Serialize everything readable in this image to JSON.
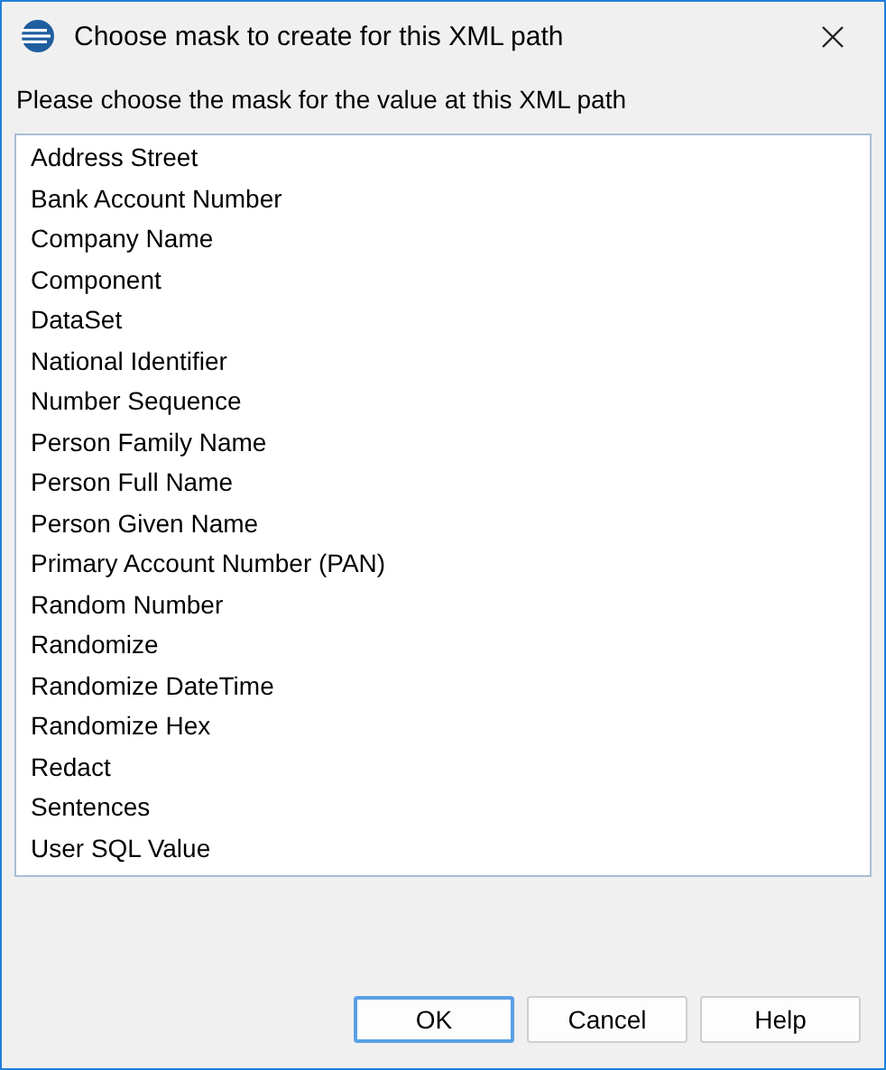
{
  "window": {
    "title": "Choose mask to create for this XML path"
  },
  "prompt": "Please choose the mask for the value at this XML path",
  "masks": [
    {
      "label": "Address Street",
      "selected": false
    },
    {
      "label": "Bank Account Number",
      "selected": false
    },
    {
      "label": "Company Name",
      "selected": false
    },
    {
      "label": "Component",
      "selected": false
    },
    {
      "label": "DataSet",
      "selected": false
    },
    {
      "label": "National Identifier",
      "selected": false
    },
    {
      "label": "Number Sequence",
      "selected": false
    },
    {
      "label": "Person Family Name",
      "selected": false
    },
    {
      "label": "Person Full Name",
      "selected": false
    },
    {
      "label": "Person Given Name",
      "selected": false
    },
    {
      "label": "Primary Account Number (PAN)",
      "selected": false
    },
    {
      "label": "Random Number",
      "selected": false
    },
    {
      "label": "Randomize",
      "selected": false
    },
    {
      "label": "Randomize DateTime",
      "selected": false
    },
    {
      "label": "Randomize Hex",
      "selected": false
    },
    {
      "label": "Redact",
      "selected": false
    },
    {
      "label": "Sentences",
      "selected": false
    },
    {
      "label": "User SQL Value",
      "selected": false
    }
  ],
  "buttons": [
    {
      "label": "OK",
      "default": true
    },
    {
      "label": "Cancel",
      "default": false
    },
    {
      "label": "Help",
      "default": false
    }
  ]
}
